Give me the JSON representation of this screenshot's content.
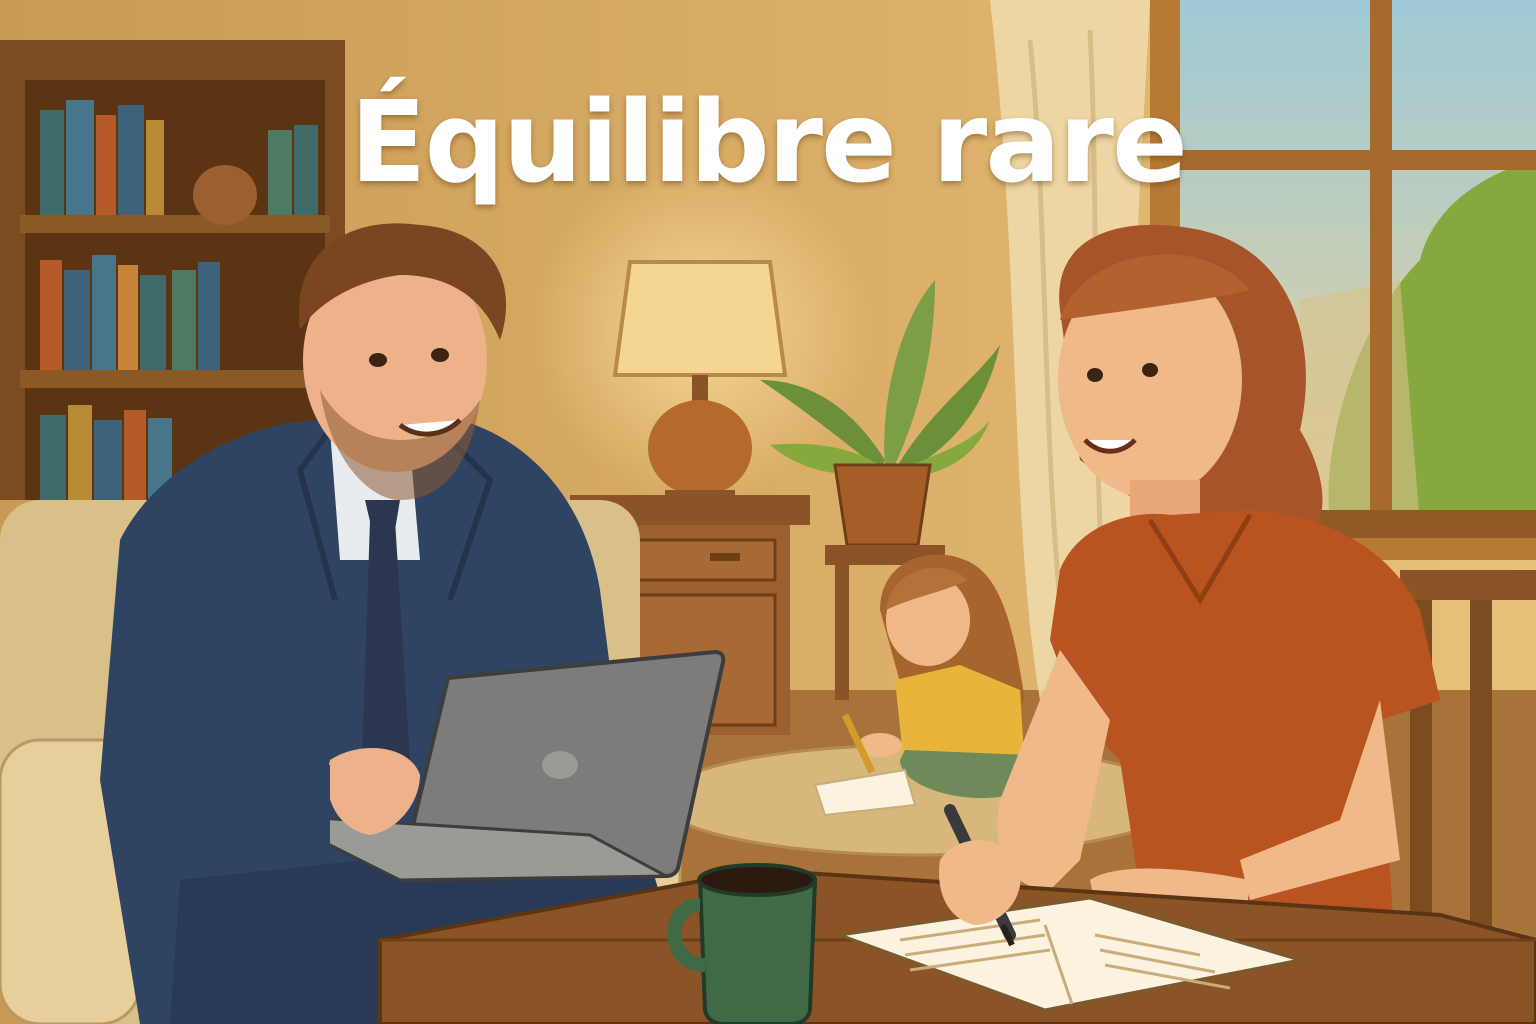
{
  "headline": "Équilibre rare",
  "palette": {
    "wall": "#d9ad66",
    "wood": "#8a5426",
    "suit": "#2f4462",
    "shirt_woman": "#b9531f",
    "child_shirt": "#e8b53a",
    "mug": "#3f6a45",
    "laptop": "#7c7c7a",
    "window_sky": "#a9cfd8",
    "foliage": "#86a83f"
  },
  "icons": [
    "bookshelf",
    "lamp",
    "potted-plant",
    "window",
    "laptop",
    "mug",
    "notebook",
    "pen"
  ]
}
